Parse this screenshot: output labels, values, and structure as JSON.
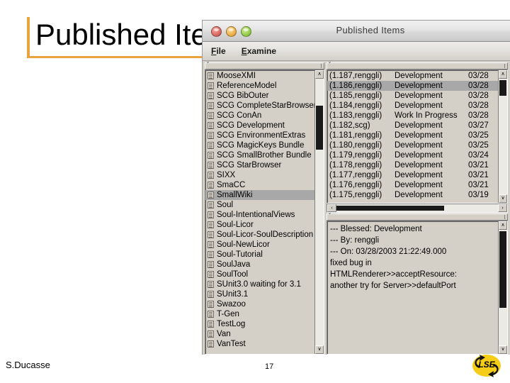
{
  "slide": {
    "title": "Published Items",
    "author": "S.Ducasse",
    "page_number": "17",
    "accent_color": "#e8a33d",
    "logo_text": "LSE"
  },
  "window": {
    "title": "Published Items",
    "traffic_lights": [
      "close-button",
      "minimize-button",
      "zoom-button"
    ],
    "menu": [
      {
        "label": "File",
        "mnemonic": "F"
      },
      {
        "label": "Examine",
        "mnemonic": "E"
      }
    ]
  },
  "package_list": {
    "selected": "SmallWiki",
    "scroll_chevron": "ˇ",
    "items": [
      "MooseXMI",
      "ReferenceModel",
      "SCG BibOuter",
      "SCG CompleteStarBrowser",
      "SCG ConAn",
      "SCG Development",
      "SCG EnvironmentExtras",
      "SCG MagicKeys Bundle",
      "SCG SmallBrother Bundle",
      "SCG StarBrowser",
      "SIXX",
      "SmaCC",
      "SmallWiki",
      "Soul",
      "Soul-IntentionalViews",
      "Soul-Licor",
      "Soul-Licor-SoulDescription",
      "Soul-NewLicor",
      "Soul-Tutorial",
      "SoulJava",
      "SoulTool",
      "SUnit3.0 waiting for 3.1",
      "SUnit3.1",
      "Swazoo",
      "T-Gen",
      "TestLog",
      "Van",
      "VanTest"
    ]
  },
  "version_list": {
    "selected_index": 1,
    "scroll_chevron": "ˇ",
    "rows": [
      {
        "id": "(1.187,renggli)",
        "status": "Development",
        "date": "03/28"
      },
      {
        "id": "(1.186,renggli)",
        "status": "Development",
        "date": "03/28"
      },
      {
        "id": "(1.185,renggli)",
        "status": "Development",
        "date": "03/28"
      },
      {
        "id": "(1.184,renggli)",
        "status": "Development",
        "date": "03/28"
      },
      {
        "id": "(1.183,renggli)",
        "status": "Work In Progress",
        "date": "03/28"
      },
      {
        "id": "(1.182,scg)",
        "status": "Development",
        "date": "03/27"
      },
      {
        "id": "(1.181,renggli)",
        "status": "Development",
        "date": "03/25"
      },
      {
        "id": "(1.180,renggli)",
        "status": "Development",
        "date": "03/25"
      },
      {
        "id": "(1.179,renggli)",
        "status": "Development",
        "date": "03/24"
      },
      {
        "id": "(1.178,renggli)",
        "status": "Development",
        "date": "03/21"
      },
      {
        "id": "(1.177,renggli)",
        "status": "Development",
        "date": "03/21"
      },
      {
        "id": "(1.176,renggli)",
        "status": "Development",
        "date": "03/21"
      },
      {
        "id": "(1.175,renggli)",
        "status": "Development",
        "date": "03/19"
      }
    ]
  },
  "details_pane": {
    "scroll_chevron": "ˇ",
    "lines": [
      "--- Blessed: Development",
      "--- By: renggli",
      "--- On: 03/28/2003 21:22:49.000",
      "fixed bug in",
      "HTMLRenderer>>acceptResource:",
      "another try for Server>>defaultPort"
    ]
  },
  "scroll_arrows": {
    "up": "∧",
    "down": "∨",
    "left": "‹",
    "right": "›"
  }
}
